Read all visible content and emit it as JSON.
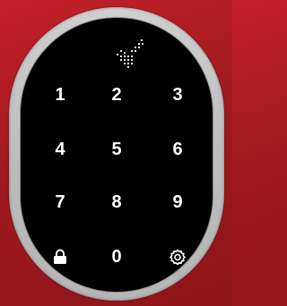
{
  "keypad": {
    "keys": [
      {
        "label": "1"
      },
      {
        "label": "2"
      },
      {
        "label": "3"
      },
      {
        "label": "4"
      },
      {
        "label": "5"
      },
      {
        "label": "6"
      },
      {
        "label": "7"
      },
      {
        "label": "8"
      },
      {
        "label": "9"
      },
      {
        "icon": "lock-icon"
      },
      {
        "label": "0"
      },
      {
        "icon": "gear-icon"
      }
    ]
  },
  "indicator": {
    "icon": "status-dot-matrix-icon"
  },
  "colors": {
    "background": "#b01c22",
    "bezel": "#c4c4c4",
    "screen": "#000000",
    "text": "#ffffff"
  }
}
